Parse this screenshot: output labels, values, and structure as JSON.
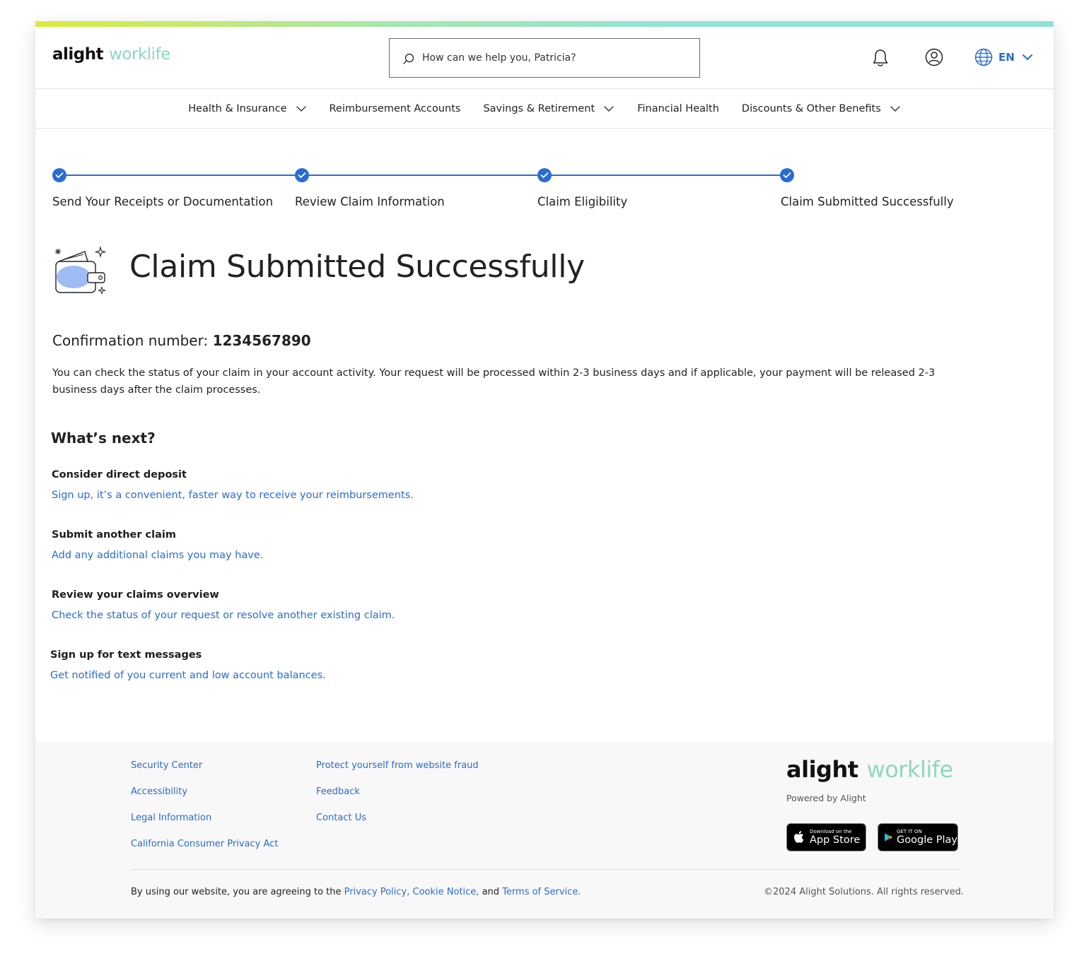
{
  "header": {
    "logo_alight": "alight",
    "logo_worklife": "worklife",
    "search_placeholder": "How can we help you, Patricia?",
    "language": "EN"
  },
  "nav": {
    "items": [
      {
        "label": "Health & Insurance",
        "has_dropdown": true
      },
      {
        "label": "Reimbursement Accounts",
        "has_dropdown": false
      },
      {
        "label": "Savings & Retirement",
        "has_dropdown": true
      },
      {
        "label": "Financial Health",
        "has_dropdown": false
      },
      {
        "label": "Discounts & Other Benefits",
        "has_dropdown": true
      }
    ]
  },
  "stepper": {
    "steps": [
      {
        "label": "Send Your Receipts or Documentation",
        "completed": true
      },
      {
        "label": "Review Claim Information",
        "completed": true
      },
      {
        "label": "Claim Eligibility",
        "completed": true
      },
      {
        "label": "Claim Submitted Successfully",
        "completed": true
      }
    ]
  },
  "main": {
    "title": "Claim Submitted Successfully",
    "confirmation_label": "Confirmation number:",
    "confirmation_number": "1234567890",
    "description": "You can check the status of your claim in your account activity. Your request will be processed within 2-3 business days and if applicable, your payment will be released 2-3 business days after the claim processes.",
    "whats_next_heading": "What’s next?",
    "next_items": [
      {
        "title": "Consider direct deposit",
        "link": "Sign up, it’s a convenient, faster way to receive your reimbursements."
      },
      {
        "title": "Submit another claim",
        "link": "Add any additional claims you may have."
      },
      {
        "title": "Review your claims overview",
        "link": "Check the status of your request or resolve another existing claim."
      },
      {
        "title": "Sign up for text messages",
        "link": "Get notified of you current and low account balances."
      }
    ]
  },
  "footer": {
    "col1": [
      "Security Center",
      "Accessibility",
      "Legal Information",
      "California Consumer Privacy Act"
    ],
    "col2": [
      "Protect yourself from website fraud",
      "Feedback",
      "Contact Us"
    ],
    "logo_alight": "alight",
    "logo_worklife": "worklife",
    "powered_by": "Powered by Alight",
    "app_store_small": "Download on the",
    "app_store_big": "App Store",
    "google_play_small": "GET IT ON",
    "google_play_big": "Google Play",
    "legal_prefix": "By using our website, you are agreeing to the",
    "privacy_policy": "Privacy Policy,",
    "cookie_notice": "Cookie Notice,",
    "legal_and": "and",
    "terms_of_service": "Terms of Service.",
    "copyright": "©2024 Alight Solutions. All rights reserved."
  },
  "colors": {
    "accent_blue": "#2a6bd3",
    "worklife_green": "#8ed8bf"
  }
}
